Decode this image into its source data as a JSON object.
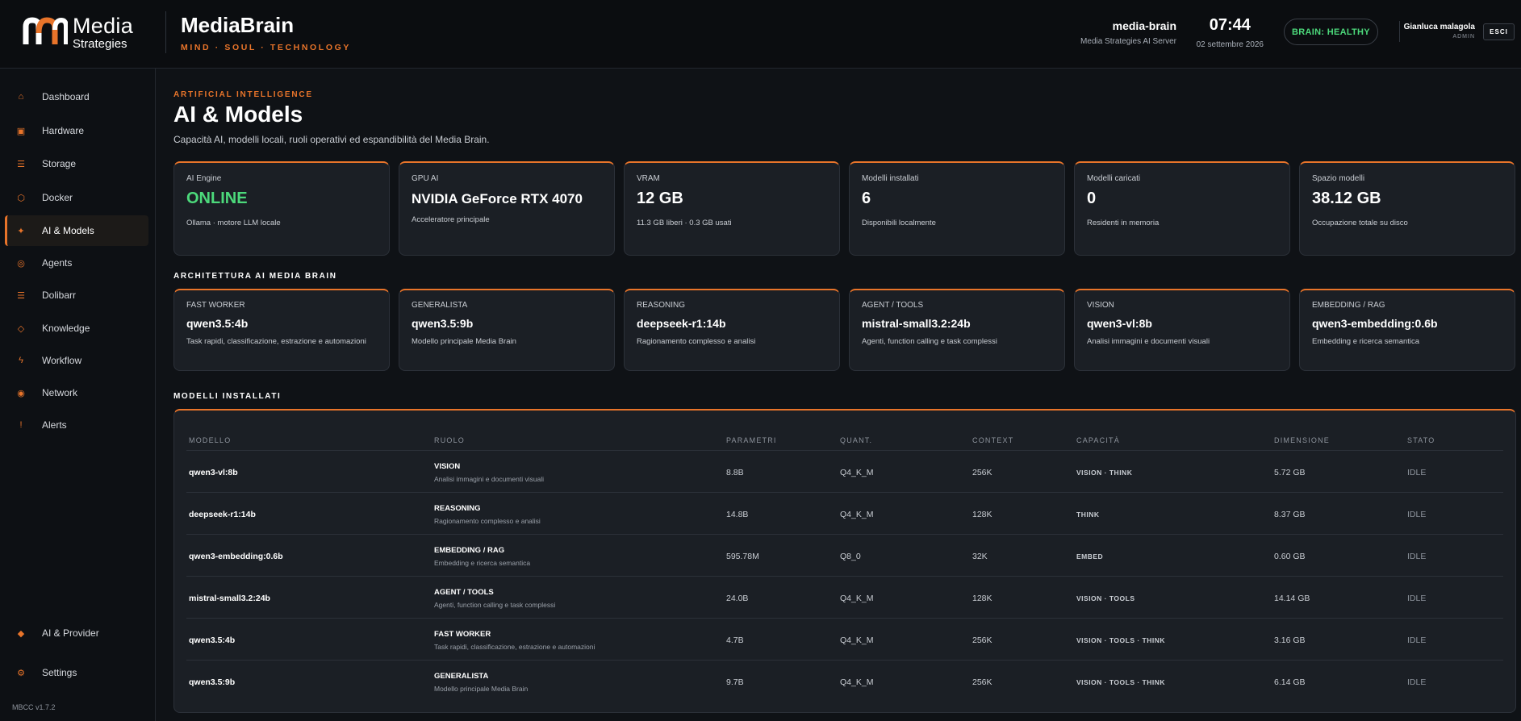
{
  "header": {
    "logo_line1": "Media",
    "logo_line2": "Strategies",
    "brand_title": "MediaBrain",
    "brand_sub": "MIND · SOUL · TECHNOLOGY",
    "host_name": "media-brain",
    "host_desc": "Media Strategies AI Server",
    "time": "07:44",
    "date": "02 settembre 2026",
    "health": "BRAIN: HEALTHY",
    "user_name": "Gianluca malagola",
    "user_role": "ADMIN",
    "logout": "ESCI"
  },
  "sidebar": {
    "items": [
      {
        "label": "Dashboard",
        "icon": "⌂"
      },
      {
        "label": "Hardware",
        "icon": "▣"
      },
      {
        "label": "Storage",
        "icon": "☰"
      },
      {
        "label": "Docker",
        "icon": "⬡"
      },
      {
        "label": "AI & Models",
        "icon": "✦"
      },
      {
        "label": "Agents",
        "icon": "◎"
      },
      {
        "label": "Dolibarr",
        "icon": "☰"
      },
      {
        "label": "Knowledge",
        "icon": "◇"
      },
      {
        "label": "Workflow",
        "icon": "ϟ"
      },
      {
        "label": "Network",
        "icon": "◉"
      },
      {
        "label": "Alerts",
        "icon": "!"
      }
    ],
    "bottom_items": [
      {
        "label": "AI & Provider",
        "icon": "◆"
      },
      {
        "label": "Settings",
        "icon": "⚙"
      }
    ],
    "version": "MBCC v1.7.2"
  },
  "page": {
    "eyebrow": "ARTIFICIAL INTELLIGENCE",
    "title": "AI & Models",
    "desc": "Capacità AI, modelli locali, ruoli operativi ed espandibilità del Media Brain."
  },
  "stats": [
    {
      "label": "AI Engine",
      "value": "ONLINE",
      "sub": "Ollama · motore LLM locale"
    },
    {
      "label": "GPU AI",
      "value": "NVIDIA GeForce RTX 4070",
      "sub": "Acceleratore principale"
    },
    {
      "label": "VRAM",
      "value": "12 GB",
      "sub": "11.3 GB liberi · 0.3 GB usati"
    },
    {
      "label": "Modelli installati",
      "value": "6",
      "sub": "Disponibili localmente"
    },
    {
      "label": "Modelli caricati",
      "value": "0",
      "sub": "Residenti in memoria"
    },
    {
      "label": "Spazio modelli",
      "value": "38.12 GB",
      "sub": "Occupazione totale su disco"
    }
  ],
  "architecture": {
    "title": "ARCHITETTURA AI MEDIA BRAIN",
    "items": [
      {
        "label": "FAST WORKER",
        "model": "qwen3.5:4b",
        "desc": "Task rapidi, classificazione, estrazione e automazioni"
      },
      {
        "label": "GENERALISTA",
        "model": "qwen3.5:9b",
        "desc": "Modello principale Media Brain"
      },
      {
        "label": "REASONING",
        "model": "deepseek-r1:14b",
        "desc": "Ragionamento complesso e analisi"
      },
      {
        "label": "AGENT / TOOLS",
        "model": "mistral-small3.2:24b",
        "desc": "Agenti, function calling e task complessi"
      },
      {
        "label": "VISION",
        "model": "qwen3-vl:8b",
        "desc": "Analisi immagini e documenti visuali"
      },
      {
        "label": "EMBEDDING / RAG",
        "model": "qwen3-embedding:0.6b",
        "desc": "Embedding e ricerca semantica"
      }
    ]
  },
  "models": {
    "title": "MODELLI INSTALLATI",
    "columns": [
      "MODELLO",
      "RUOLO",
      "PARAMETRI",
      "QUANT.",
      "CONTEXT",
      "CAPACITÀ",
      "DIMENSIONE",
      "STATO"
    ],
    "rows": [
      {
        "model": "qwen3-vl:8b",
        "role": "VISION",
        "role_desc": "Analisi immagini e documenti visuali",
        "params": "8.8B",
        "quant": "Q4_K_M",
        "context": "256K",
        "caps": "VISION · THINK",
        "size": "5.72 GB",
        "status": "IDLE"
      },
      {
        "model": "deepseek-r1:14b",
        "role": "REASONING",
        "role_desc": "Ragionamento complesso e analisi",
        "params": "14.8B",
        "quant": "Q4_K_M",
        "context": "128K",
        "caps": "THINK",
        "size": "8.37 GB",
        "status": "IDLE"
      },
      {
        "model": "qwen3-embedding:0.6b",
        "role": "EMBEDDING / RAG",
        "role_desc": "Embedding e ricerca semantica",
        "params": "595.78M",
        "quant": "Q8_0",
        "context": "32K",
        "caps": "EMBED",
        "size": "0.60 GB",
        "status": "IDLE"
      },
      {
        "model": "mistral-small3.2:24b",
        "role": "AGENT / TOOLS",
        "role_desc": "Agenti, function calling e task complessi",
        "params": "24.0B",
        "quant": "Q4_K_M",
        "context": "128K",
        "caps": "VISION · TOOLS",
        "size": "14.14 GB",
        "status": "IDLE"
      },
      {
        "model": "qwen3.5:4b",
        "role": "FAST WORKER",
        "role_desc": "Task rapidi, classificazione, estrazione e automazioni",
        "params": "4.7B",
        "quant": "Q4_K_M",
        "context": "256K",
        "caps": "VISION · TOOLS · THINK",
        "size": "3.16 GB",
        "status": "IDLE"
      },
      {
        "model": "qwen3.5:9b",
        "role": "GENERALISTA",
        "role_desc": "Modello principale Media Brain",
        "params": "9.7B",
        "quant": "Q4_K_M",
        "context": "256K",
        "caps": "VISION · TOOLS · THINK",
        "size": "6.14 GB",
        "status": "IDLE"
      }
    ]
  },
  "colors": {
    "accent": "#e8742a",
    "healthy": "#4cd97b",
    "background": "#0f1216",
    "card": "#1b1f25"
  }
}
